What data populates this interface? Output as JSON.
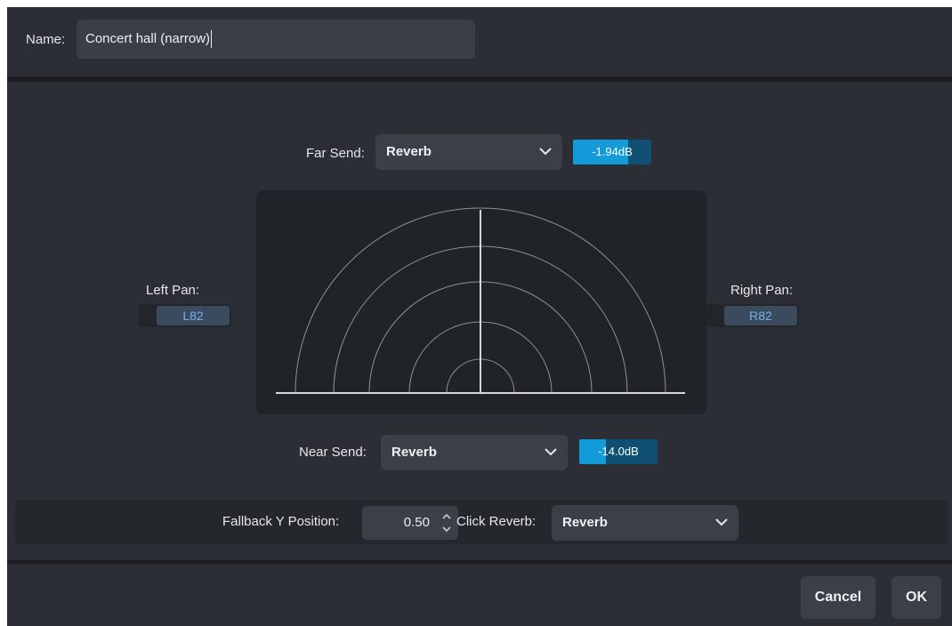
{
  "name_row": {
    "label": "Name:",
    "value": "Concert hall (narrow)"
  },
  "far_send": {
    "label": "Far Send:",
    "selected": "Reverb",
    "level": "-1.94dB",
    "level_fill": 0.71
  },
  "near_send": {
    "label": "Near Send:",
    "selected": "Reverb",
    "level": "-14.0dB",
    "level_fill": 0.34
  },
  "left_pan": {
    "label": "Left Pan:",
    "value": "L82"
  },
  "right_pan": {
    "label": "Right Pan:",
    "value": "R82"
  },
  "fallback": {
    "label": "Fallback Y Position:",
    "value": "0.50"
  },
  "click_reverb": {
    "label": "Click Reverb:",
    "selected": "Reverb"
  },
  "buttons": {
    "cancel": "Cancel",
    "ok": "OK"
  },
  "icons": {
    "dropdown": "chevron-down-icon",
    "spin_up": "chevron-up-icon",
    "spin_down": "chevron-down-icon"
  },
  "colors": {
    "accent": "#129bd8",
    "meter_bg": "#0f4f72",
    "pan_text": "#6fb4ee",
    "dialog_bg": "#2b2e34"
  }
}
